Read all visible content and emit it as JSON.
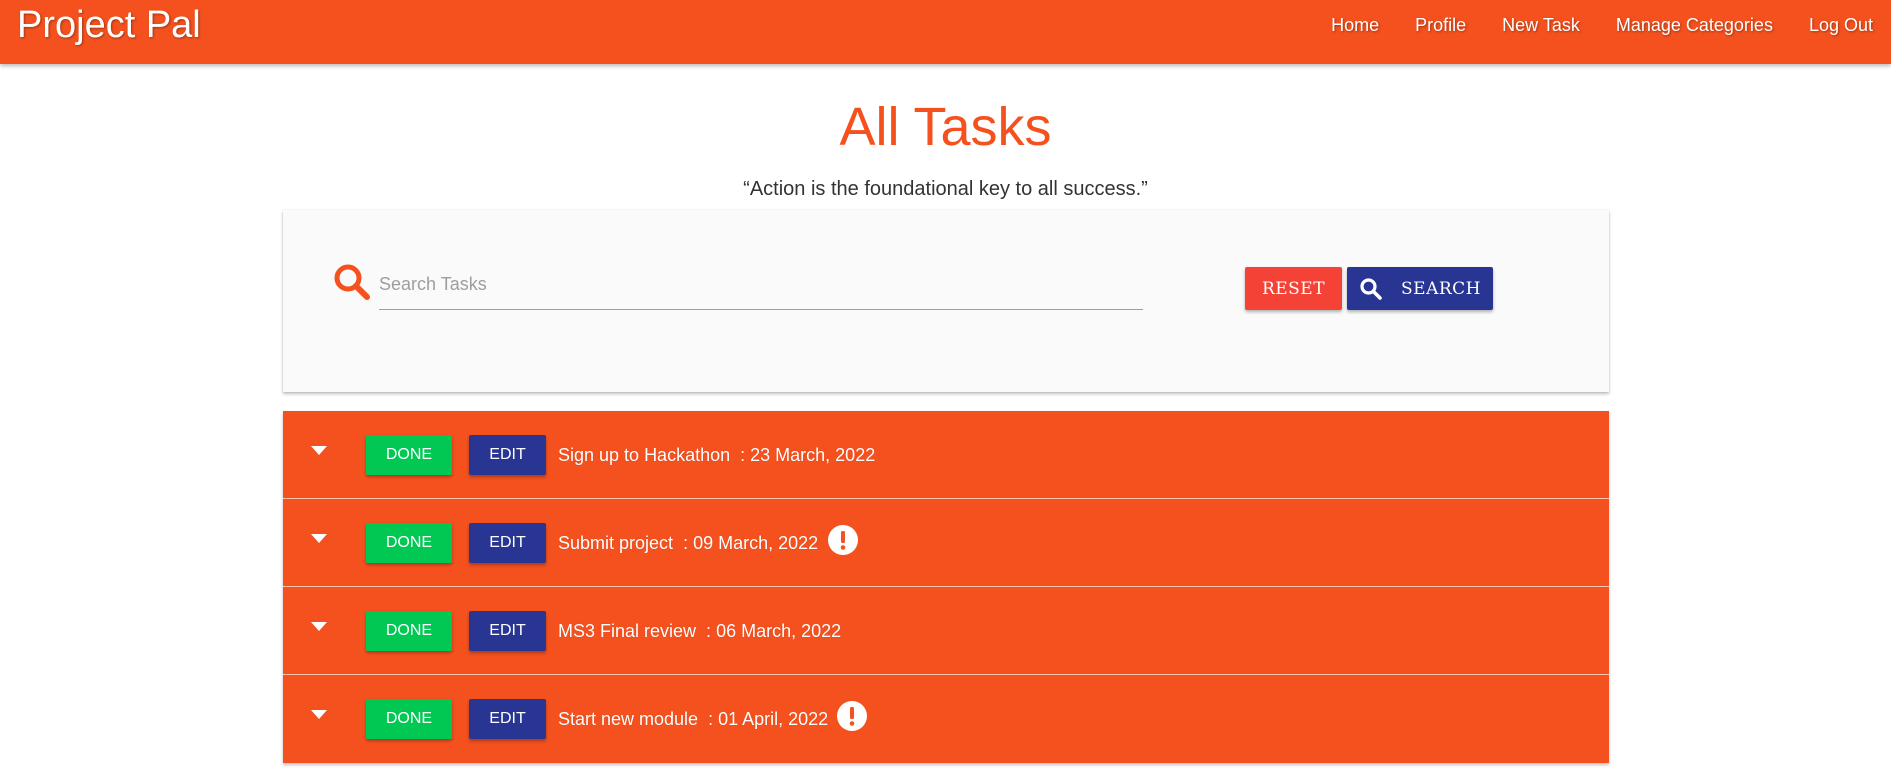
{
  "navbar": {
    "brand": "Project Pal",
    "links": [
      {
        "label": "Home"
      },
      {
        "label": "Profile"
      },
      {
        "label": "New Task"
      },
      {
        "label": "Manage Categories"
      },
      {
        "label": "Log Out"
      }
    ]
  },
  "main": {
    "title": "All Tasks",
    "quote": "“Action is the foundational key to all success.”"
  },
  "search": {
    "placeholder": "Search Tasks",
    "value": "",
    "reset_label": "RESET",
    "search_label": "SEARCH",
    "icon": "search-icon"
  },
  "tasks": [
    {
      "name": "Sign up to Hackathon",
      "date": "23 March, 2022",
      "urgent": false,
      "done_label": "DONE",
      "edit_label": "EDIT"
    },
    {
      "name": "Submit project",
      "date": "09 March, 2022",
      "urgent": true,
      "done_label": "DONE",
      "edit_label": "EDIT"
    },
    {
      "name": "MS3 Final review",
      "date": "06 March, 2022",
      "urgent": false,
      "done_label": "DONE",
      "edit_label": "EDIT"
    },
    {
      "name": "Start new module",
      "date": "01 April, 2022",
      "urgent": true,
      "done_label": "DONE",
      "edit_label": "EDIT"
    }
  ],
  "colors": {
    "primary": "#f4511e",
    "done": "#00c853",
    "edit": "#283593",
    "reset": "#f44336"
  }
}
